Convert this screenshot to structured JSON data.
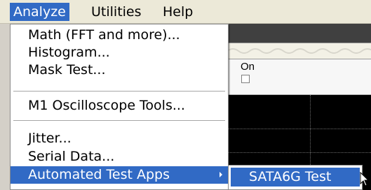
{
  "menubar": {
    "items": [
      "Analyze",
      "Utilities",
      "Help"
    ],
    "active": "Analyze"
  },
  "analyze_menu": {
    "groups": [
      [
        "Math (FFT and more)...",
        "Histogram...",
        "Mask Test..."
      ],
      [
        "M1 Oscilloscope Tools..."
      ],
      [
        "Jitter...",
        "Serial Data...",
        "Automated Test Apps"
      ]
    ],
    "highlighted": "Automated Test Apps"
  },
  "submenu": {
    "items": [
      "SATA6G Test"
    ]
  },
  "panel": {
    "on_label": "On",
    "on_checked": false
  },
  "colors": {
    "highlight": "#316ac5",
    "menubar": "#ece9d8",
    "scope_bg": "#000000"
  }
}
